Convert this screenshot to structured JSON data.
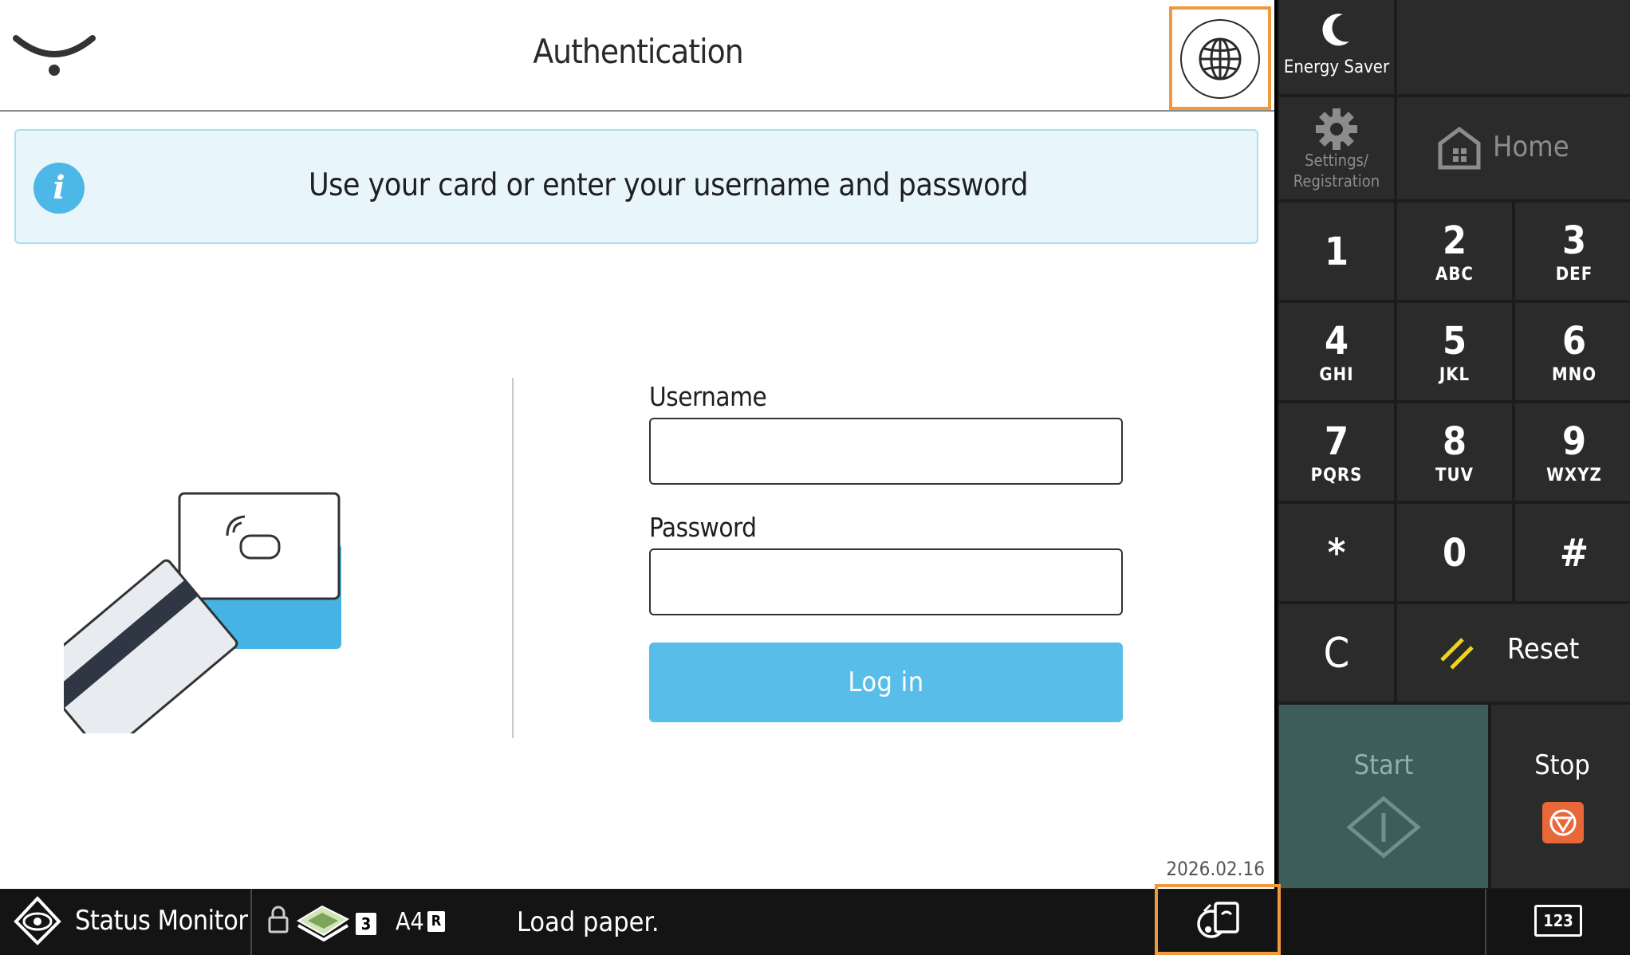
{
  "header": {
    "title": "Authentication",
    "collapse_icon": "chevron-down-icon",
    "language_icon": "globe-icon"
  },
  "banner": {
    "icon": "info-icon",
    "icon_glyph": "i",
    "message": "Use your card or enter your username and password"
  },
  "login_form": {
    "username_label": "Username",
    "username_value": "",
    "password_label": "Password",
    "password_value": "",
    "login_button": "Log in"
  },
  "footer": {
    "date": "2026.02.16"
  },
  "side_panel": {
    "energy_saver": "Energy Saver",
    "settings_line1": "Settings/",
    "settings_line2": "Registration",
    "home": "Home",
    "keypad": [
      {
        "num": "1",
        "letters": ""
      },
      {
        "num": "2",
        "letters": "ABC"
      },
      {
        "num": "3",
        "letters": "DEF"
      },
      {
        "num": "4",
        "letters": "GHI"
      },
      {
        "num": "5",
        "letters": "JKL"
      },
      {
        "num": "6",
        "letters": "MNO"
      },
      {
        "num": "7",
        "letters": "PQRS"
      },
      {
        "num": "8",
        "letters": "TUV"
      },
      {
        "num": "9",
        "letters": "WXYZ"
      },
      {
        "num": "*",
        "letters": ""
      },
      {
        "num": "0",
        "letters": ""
      },
      {
        "num": "#",
        "letters": ""
      }
    ],
    "clear": "C",
    "reset": "Reset",
    "start": "Start",
    "stop": "Stop"
  },
  "status_bar": {
    "status_monitor": "Status Monitor",
    "tray_number": "3",
    "paper_size": "A4",
    "paper_orientation": "R",
    "message": "Load paper.",
    "keypad_label": "123"
  },
  "colors": {
    "accent_highlight": "#ee9a3a",
    "login_button": "#58bde9",
    "info_banner_bg": "#e8f5fb",
    "start_button": "#3d5d58",
    "stop_icon": "#e8683a",
    "reset_slash": "#f1d21c"
  }
}
